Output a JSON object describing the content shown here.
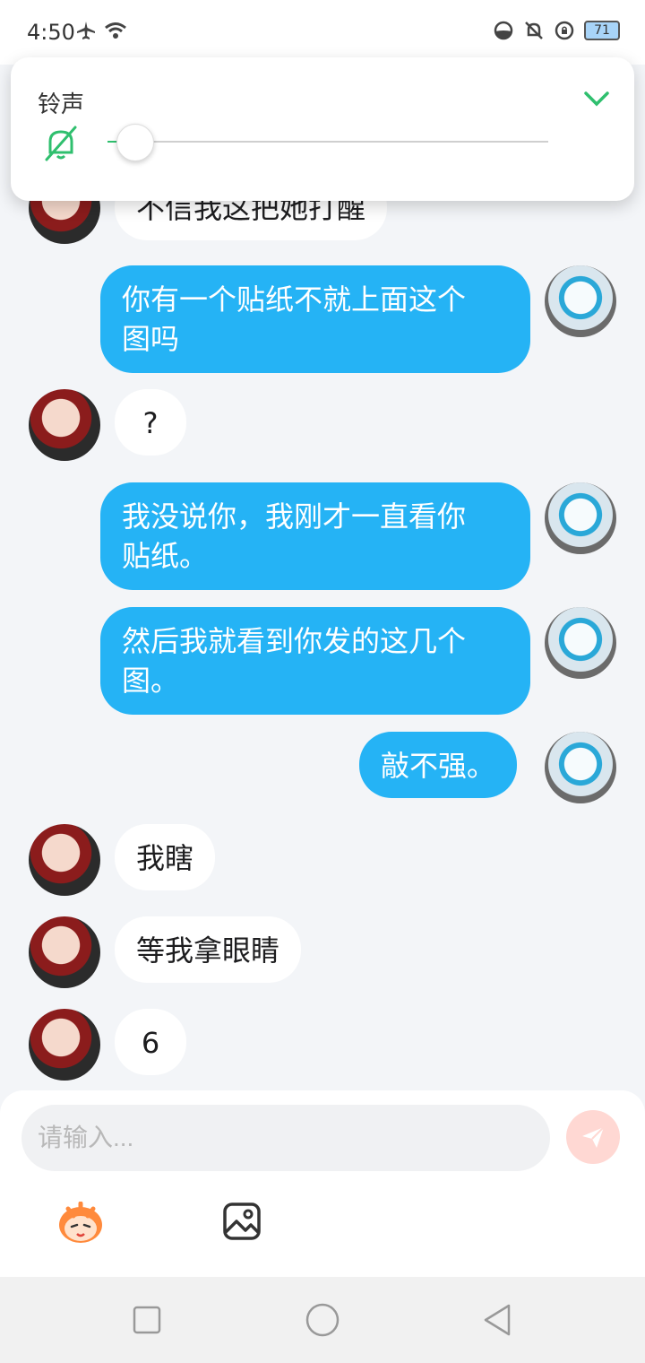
{
  "status_bar": {
    "time": "4:50",
    "battery": "71"
  },
  "volume_panel": {
    "label": "铃声",
    "level_fraction": 0.0
  },
  "messages": [
    {
      "side": "in",
      "text": "不信我这把她打醒"
    },
    {
      "side": "out",
      "lines": [
        "你有一个贴纸不就上面这个",
        "图吗"
      ]
    },
    {
      "side": "in",
      "text": "?"
    },
    {
      "side": "out",
      "lines": [
        "我没说你，我刚才一直看你",
        "贴纸。"
      ]
    },
    {
      "side": "out",
      "lines": [
        "然后我就看到你发的这几个",
        "图。"
      ]
    },
    {
      "side": "out",
      "text": "敲不强。"
    },
    {
      "side": "in",
      "text": "我瞎"
    },
    {
      "side": "in",
      "text": "等我拿眼睛"
    },
    {
      "side": "in",
      "text": "6"
    }
  ],
  "input": {
    "placeholder": "请输入..."
  },
  "colors": {
    "outgoing_bubble": "#25b3f5",
    "incoming_bubble": "#ffffff",
    "accent_green": "#2fbf6e",
    "send_button": "#ffd8d3"
  }
}
